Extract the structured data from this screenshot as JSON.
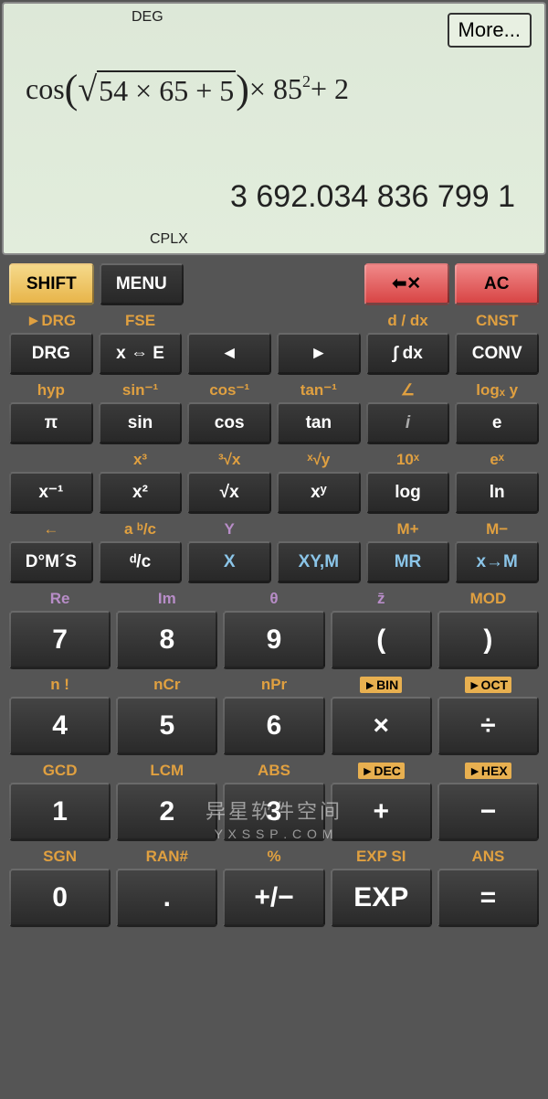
{
  "display": {
    "mode_angle": "DEG",
    "mode_cplx": "CPLX",
    "more_label": "More...",
    "expression_prefix": "cos",
    "expression_sqrt_inner": "54 × 65 + 5",
    "expression_mult": " × 85",
    "expression_exp": "2",
    "expression_suffix": " + 2",
    "result": "3 692.034 836 799 1"
  },
  "toprow": {
    "shift": "SHIFT",
    "menu": "MENU",
    "backspace_icon": "⌫",
    "ac": "AC"
  },
  "alt1": [
    "►DRG",
    "FSE",
    "",
    "",
    "d / dx",
    "CNST"
  ],
  "row1": [
    "DRG",
    "x ⇔ E",
    "◄",
    "►",
    "∫ dx",
    "CONV"
  ],
  "alt2": [
    "hyp",
    "sin⁻¹",
    "cos⁻¹",
    "tan⁻¹",
    "∠",
    "logₓ y"
  ],
  "row2": [
    "π",
    "sin",
    "cos",
    "tan",
    "i",
    "e"
  ],
  "alt3": [
    "",
    "x³",
    "³√x",
    "ˣ√y",
    "10ˣ",
    "eˣ"
  ],
  "row3": [
    "x⁻¹",
    "x²",
    "√x",
    "xʸ",
    "log",
    "ln"
  ],
  "alt4": [
    "←",
    "a ᵇ/c",
    "Y",
    "",
    "M+",
    "M−"
  ],
  "row4": [
    "D°M´S",
    "ᵈ/c",
    "X",
    "XY,M",
    "MR",
    "x→M"
  ],
  "alt5": [
    "Re",
    "Im",
    "θ",
    "z̄",
    "MOD"
  ],
  "row5": [
    "7",
    "8",
    "9",
    "(",
    ")"
  ],
  "alt6": [
    "n !",
    "nCr",
    "nPr",
    "►BIN",
    "►OCT"
  ],
  "row6": [
    "4",
    "5",
    "6",
    "×",
    "÷"
  ],
  "alt7": [
    "GCD",
    "LCM",
    "ABS",
    "►DEC",
    "►HEX"
  ],
  "row7": [
    "1",
    "2",
    "3",
    "+",
    "−"
  ],
  "alt8": [
    "SGN",
    "RAN#",
    "%",
    "EXP SI",
    "ANS"
  ],
  "row8": [
    "0",
    ".",
    "+/−",
    "EXP",
    "="
  ],
  "watermark": {
    "line1": "异星软件空间",
    "line2": "Y X S S P . C O M"
  }
}
